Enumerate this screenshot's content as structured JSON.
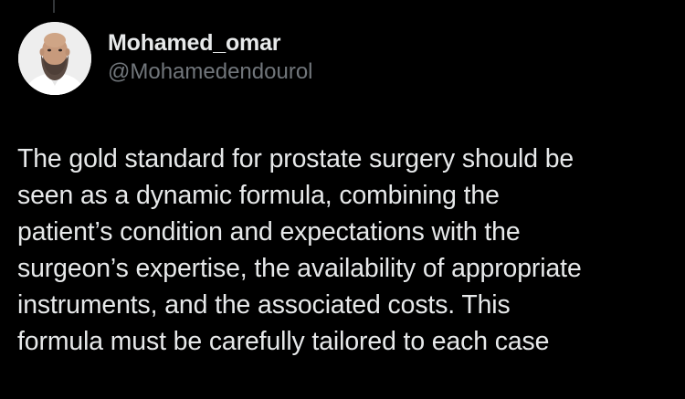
{
  "author": {
    "display_name": "Mohamed_omar",
    "handle": "@Mohamedendourol",
    "avatar_icon": "user-avatar-photo"
  },
  "tweet": {
    "text": "The gold standard for prostate surgery should be\nseen as a dynamic formula, combining the\npatient’s condition and expectations with the\nsurgeon’s expertise, the availability of appropriate\ninstruments, and the associated costs. This\nformula must be carefully tailored to each case"
  },
  "colors": {
    "background": "#000000",
    "primary_text": "#e7e9ea",
    "secondary_text": "#71767b",
    "thread_line": "#333639"
  }
}
